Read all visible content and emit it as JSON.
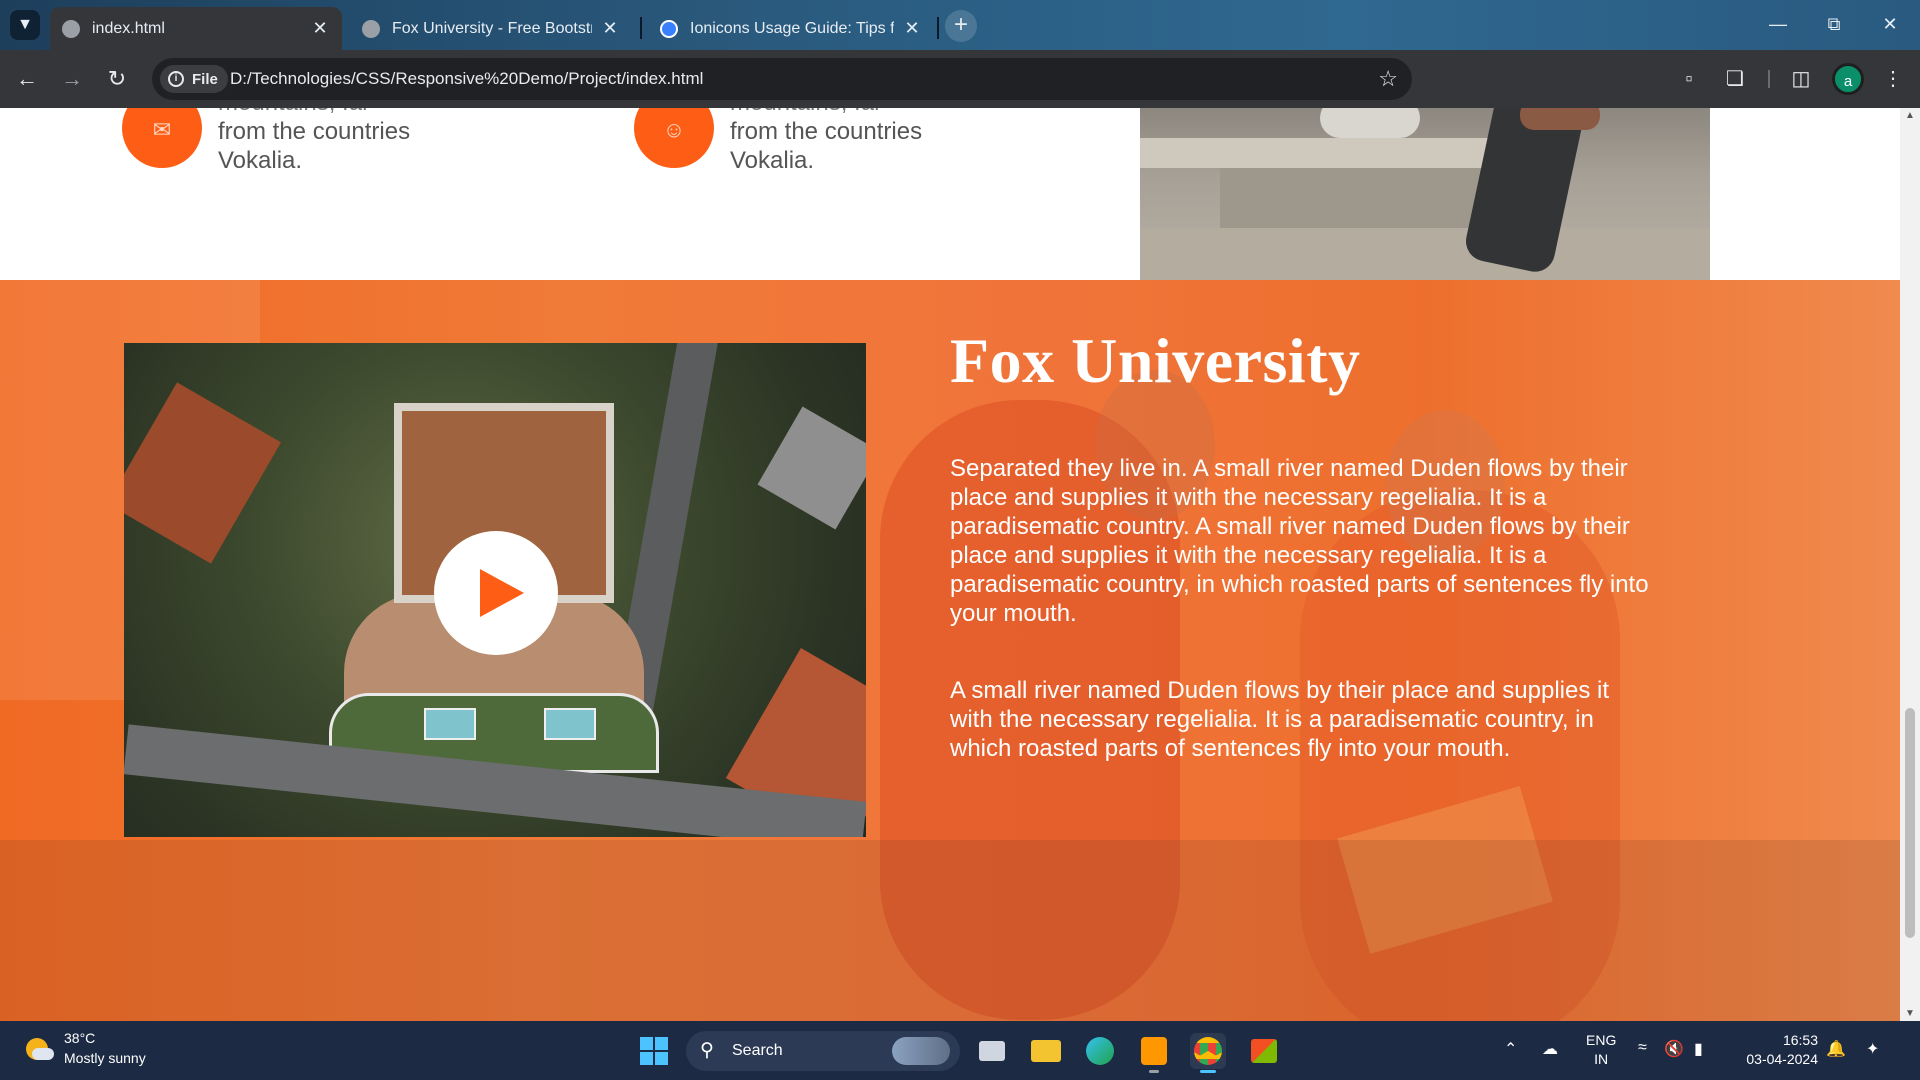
{
  "browser": {
    "tabs": [
      {
        "title": "index.html",
        "active": true
      },
      {
        "title": "Fox University - Free Bootstrap",
        "active": false
      },
      {
        "title": "Ionicons Usage Guide: Tips for",
        "active": false
      }
    ],
    "site_chip": "File",
    "url": "D:/Technologies/CSS/Responsive%20Demo/Project/index.html",
    "profile_initial": "a"
  },
  "page": {
    "features": [
      {
        "ghost_line": "mountains, far",
        "lines": [
          "from the countries",
          "Vokalia."
        ],
        "icon": "handshake-icon"
      },
      {
        "ghost_line": "mountains, far",
        "lines": [
          "from the countries",
          "Vokalia."
        ],
        "icon": "people-icon"
      }
    ],
    "promo": {
      "title": "Fox University",
      "paragraph1": "Separated they live in. A small river named Duden flows by their place and supplies it with the necessary regelialia. It is a paradisematic country. A small river named Duden flows by their place and supplies it with the necessary regelialia. It is a paradisematic country, in which roasted parts of sentences fly into your mouth.",
      "paragraph2": "A small river named Duden flows by their place and supplies it with the necessary regelialia. It is a paradisematic country, in which roasted parts of sentences fly into your mouth.",
      "accent_color": "#fd5d14"
    }
  },
  "taskbar": {
    "weather_temp": "38°C",
    "weather_condition": "Mostly sunny",
    "search_label": "Search",
    "lang_line1": "ENG",
    "lang_line2": "IN",
    "time": "16:53",
    "date": "03-04-2024"
  }
}
